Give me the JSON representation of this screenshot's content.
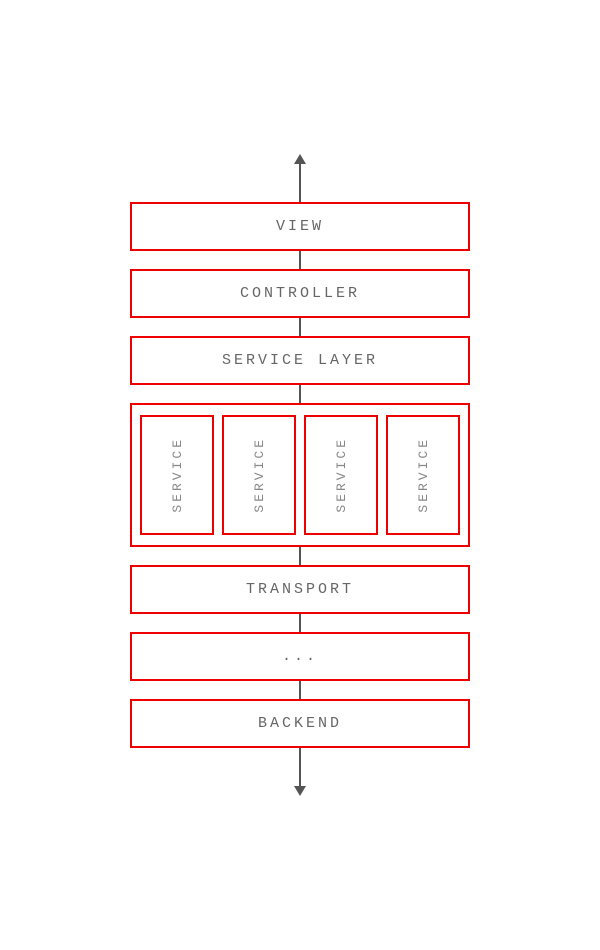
{
  "diagram": {
    "arrow_up_label": "up",
    "arrow_down_label": "down",
    "boxes": [
      {
        "id": "view",
        "label": "VIEW"
      },
      {
        "id": "controller",
        "label": "CONTROLLER"
      },
      {
        "id": "service-layer",
        "label": "SERVICE LAYER"
      },
      {
        "id": "transport",
        "label": "TRANSPORT"
      },
      {
        "id": "dots",
        "label": "..."
      },
      {
        "id": "backend",
        "label": "BACKEND"
      }
    ],
    "services": [
      {
        "id": "service-1",
        "label": "SERVICE"
      },
      {
        "id": "service-2",
        "label": "SERVICE"
      },
      {
        "id": "service-3",
        "label": "SERVICE"
      },
      {
        "id": "service-4",
        "label": "SERVICE"
      }
    ]
  }
}
